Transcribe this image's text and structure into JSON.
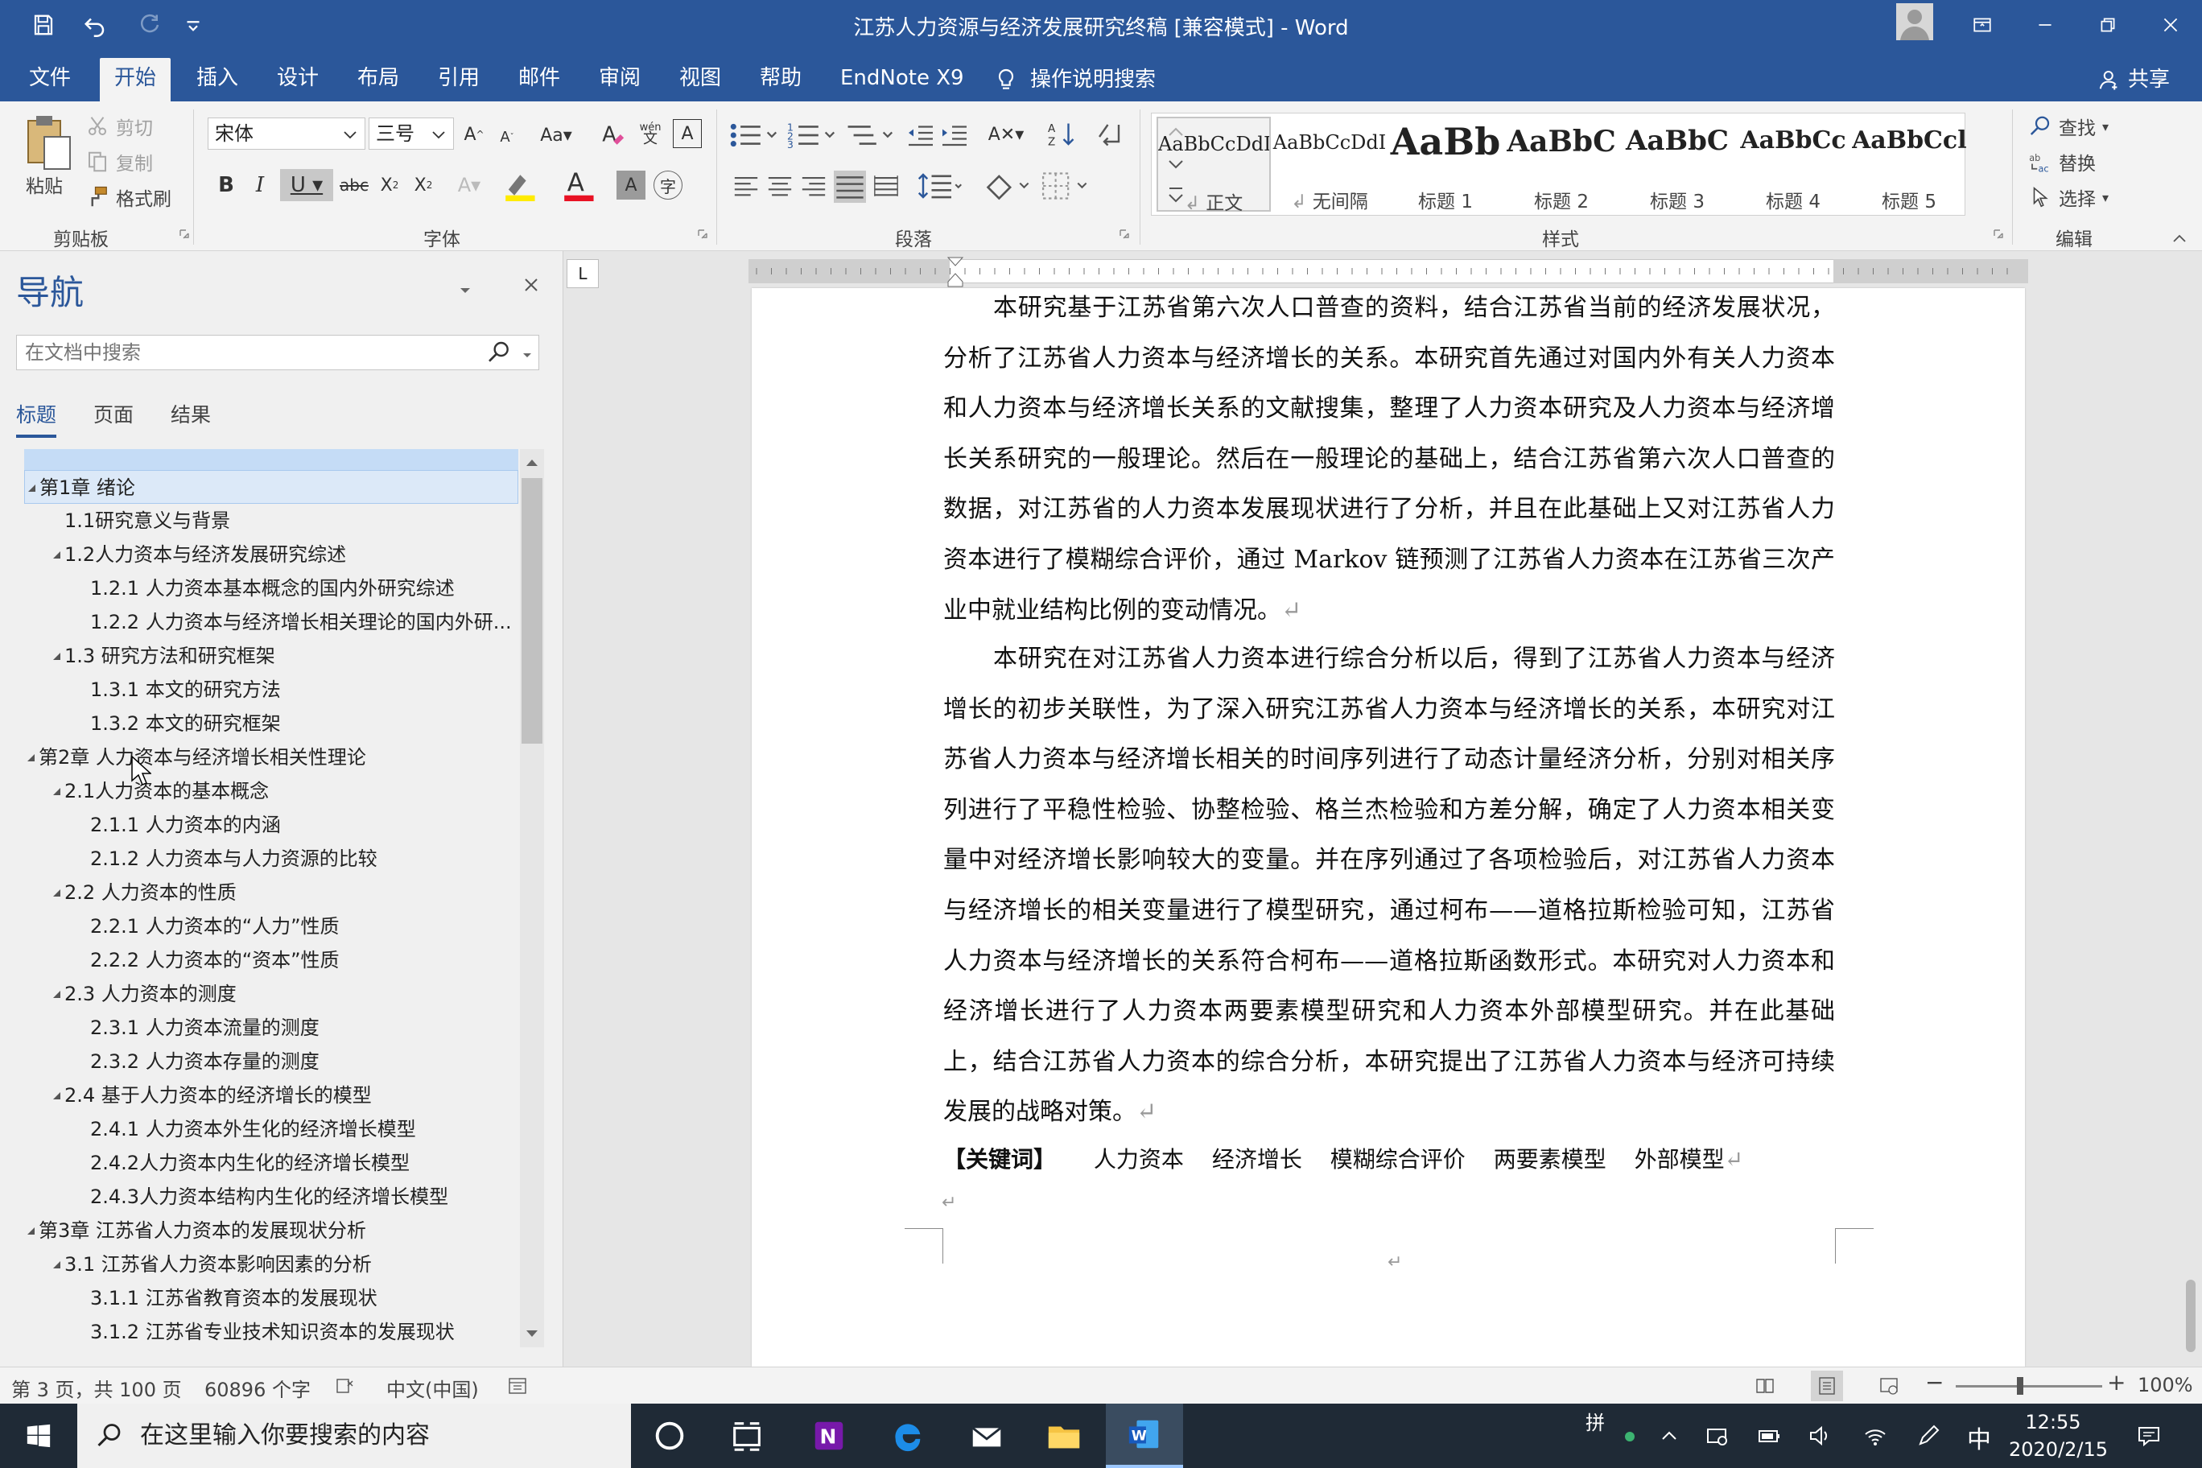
{
  "window": {
    "title": "江苏人力资源与经济发展研究终稿 [兼容模式] - Word"
  },
  "menu": {
    "tabs": [
      "文件",
      "开始",
      "插入",
      "设计",
      "布局",
      "引用",
      "邮件",
      "审阅",
      "视图",
      "帮助",
      "EndNote X9"
    ],
    "active_tab": "开始",
    "tell_me": "操作说明搜索",
    "share": "共享"
  },
  "ribbon": {
    "clipboard": {
      "label": "剪贴板",
      "paste": "粘贴",
      "cut": "剪切",
      "copy": "复制",
      "format_painter": "格式刷"
    },
    "font": {
      "label": "字体",
      "font_name": "宋体",
      "font_size": "三号"
    },
    "paragraph": {
      "label": "段落"
    },
    "styles": {
      "label": "样式",
      "items": [
        {
          "preview": "AaBbCcDdI",
          "name": "正文"
        },
        {
          "preview": "AaBbCcDdI",
          "name": "无间隔"
        },
        {
          "preview": "AaBb",
          "name": "标题 1"
        },
        {
          "preview": "AaBbC",
          "name": "标题 2"
        },
        {
          "preview": "AaBbC",
          "name": "标题 3"
        },
        {
          "preview": "AaBbCc",
          "name": "标题 4"
        },
        {
          "preview": "AaBbCcl",
          "name": "标题 5"
        }
      ]
    },
    "editing": {
      "label": "编辑",
      "find": "查找",
      "replace": "替换",
      "select": "选择"
    }
  },
  "nav": {
    "title": "导航",
    "search_placeholder": "在文档中搜索",
    "tabs": [
      "标题",
      "页面",
      "结果"
    ],
    "tree": [
      {
        "label": "第1章  绪论",
        "level": 0,
        "caret": true,
        "selected": true
      },
      {
        "label": "1.1研究意义与背景",
        "level": 1,
        "caret": false
      },
      {
        "label": "1.2人力资本与经济发展研究综述",
        "level": 1,
        "caret": true
      },
      {
        "label": "1.2.1 人力资本基本概念的国内外研究综述",
        "level": 2,
        "caret": false
      },
      {
        "label": "1.2.2 人力资本与经济增长相关理论的国内外研...",
        "level": 2,
        "caret": false
      },
      {
        "label": "1.3 研究方法和研究框架",
        "level": 1,
        "caret": true
      },
      {
        "label": "1.3.1 本文的研究方法",
        "level": 2,
        "caret": false
      },
      {
        "label": "1.3.2 本文的研究框架",
        "level": 2,
        "caret": false
      },
      {
        "label": "第2章   人力资本与经济增长相关性理论",
        "level": 0,
        "caret": true
      },
      {
        "label": "2.1人力资本的基本概念",
        "level": 1,
        "caret": true
      },
      {
        "label": "2.1.1 人力资本的内涵",
        "level": 2,
        "caret": false
      },
      {
        "label": "2.1.2 人力资本与人力资源的比较",
        "level": 2,
        "caret": false
      },
      {
        "label": "2.2 人力资本的性质",
        "level": 1,
        "caret": true
      },
      {
        "label": "2.2.1 人力资本的“人力”性质",
        "level": 2,
        "caret": false
      },
      {
        "label": "2.2.2 人力资本的“资本”性质",
        "level": 2,
        "caret": false
      },
      {
        "label": "2.3 人力资本的测度",
        "level": 1,
        "caret": true
      },
      {
        "label": "2.3.1 人力资本流量的测度",
        "level": 2,
        "caret": false
      },
      {
        "label": "2.3.2 人力资本存量的测度",
        "level": 2,
        "caret": false
      },
      {
        "label": "2.4 基于人力资本的经济增长的模型",
        "level": 1,
        "caret": true
      },
      {
        "label": "2.4.1 人力资本外生化的经济增长模型",
        "level": 2,
        "caret": false
      },
      {
        "label": "2.4.2人力资本内生化的经济增长模型",
        "level": 2,
        "caret": false
      },
      {
        "label": "2.4.3人力资本结构内生化的经济增长模型",
        "level": 2,
        "caret": false
      },
      {
        "label": "第3章  江苏省人力资本的发展现状分析",
        "level": 0,
        "caret": true
      },
      {
        "label": "3.1 江苏省人力资本影响因素的分析",
        "level": 1,
        "caret": true
      },
      {
        "label": "3.1.1 江苏省教育资本的发展现状",
        "level": 2,
        "caret": false
      },
      {
        "label": "3.1.2 江苏省专业技术知识资本的发展现状",
        "level": 2,
        "caret": false
      }
    ]
  },
  "document": {
    "paragraphs": [
      "本研究基于江苏省第六次人口普查的资料，结合江苏省当前的经济发展状况，分析了江苏省人力资本与经济增长的关系。本研究首先通过对国内外有关人力资本和人力资本与经济增长关系的文献搜集，整理了人力资本研究及人力资本与经济增长关系研究的一般理论。然后在一般理论的基础上，结合江苏省第六次人口普查的数据，对江苏省的人力资本发展现状进行了分析，并且在此基础上又对江苏省人力资本进行了模糊综合评价，通过 Markov 链预测了江苏省人力资本在江苏省三次产业中就业结构比例的变动情况。",
      "本研究在对江苏省人力资本进行综合分析以后，得到了江苏省人力资本与经济增长的初步关联性，为了深入研究江苏省人力资本与经济增长的关系，本研究对江苏省人力资本与经济增长相关的时间序列进行了动态计量经济分析，分别对相关序列进行了平稳性检验、协整检验、格兰杰检验和方差分解，确定了人力资本相关变量中对经济增长影响较大的变量。并在序列通过了各项检验后，对江苏省人力资本与经济增长的相关变量进行了模型研究，通过柯布——道格拉斯检验可知，江苏省人力资本与经济增长的关系符合柯布——道格拉斯函数形式。本研究对人力资本和经济增长进行了人力资本两要素模型研究和人力资本外部模型研究。并在此基础上，结合江苏省人力资本的综合分析，本研究提出了江苏省人力资本与经济可持续发展的战略对策。"
    ],
    "keywords_prefix": "【关键词】",
    "keywords": [
      "人力资本",
      "经济增长",
      "模糊综合评价",
      "两要素模型",
      "外部模型"
    ]
  },
  "status": {
    "page": "第 3 页，共 100 页",
    "words": "60896 个字",
    "language": "中文(中国)",
    "zoom": "100%"
  },
  "taskbar": {
    "search_placeholder": "在这里输入你要搜索的内容",
    "time": "12:55",
    "date": "2020/2/15",
    "ime": "中",
    "ime_mode": "拼"
  }
}
